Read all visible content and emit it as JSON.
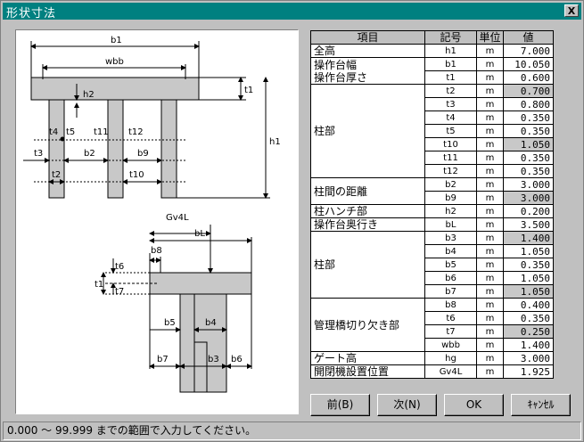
{
  "window": {
    "title": "形状寸法",
    "close": "X"
  },
  "table": {
    "headers": {
      "item": "項目",
      "symbol": "記号",
      "unit": "単位",
      "value": "値"
    },
    "rows": [
      {
        "item": "全高",
        "span": 1,
        "symbol": "h1",
        "unit": "m",
        "value": "7.000",
        "shaded": false
      },
      {
        "item": "操作台幅\n操作台厚さ",
        "span": 2,
        "symbol": "b1",
        "unit": "m",
        "value": "10.050",
        "shaded": false
      },
      {
        "symbol": "t1",
        "unit": "m",
        "value": "0.600",
        "shaded": false
      },
      {
        "item": "柱部",
        "span": 7,
        "symbol": "t2",
        "unit": "m",
        "value": "0.700",
        "shaded": true
      },
      {
        "symbol": "t3",
        "unit": "m",
        "value": "0.800",
        "shaded": false
      },
      {
        "symbol": "t4",
        "unit": "m",
        "value": "0.350",
        "shaded": false
      },
      {
        "symbol": "t5",
        "unit": "m",
        "value": "0.350",
        "shaded": false
      },
      {
        "symbol": "t10",
        "unit": "m",
        "value": "1.050",
        "shaded": true
      },
      {
        "symbol": "t11",
        "unit": "m",
        "value": "0.350",
        "shaded": false
      },
      {
        "symbol": "t12",
        "unit": "m",
        "value": "0.350",
        "shaded": false
      },
      {
        "item": "柱間の距離",
        "span": 2,
        "symbol": "b2",
        "unit": "m",
        "value": "3.000",
        "shaded": false
      },
      {
        "symbol": "b9",
        "unit": "m",
        "value": "3.000",
        "shaded": true
      },
      {
        "item": "柱ハンチ部",
        "span": 1,
        "symbol": "h2",
        "unit": "m",
        "value": "0.200",
        "shaded": false
      },
      {
        "item": "操作台奥行き",
        "span": 1,
        "symbol": "bL",
        "unit": "m",
        "value": "3.500",
        "shaded": false
      },
      {
        "item": "柱部",
        "span": 5,
        "symbol": "b3",
        "unit": "m",
        "value": "1.400",
        "shaded": true
      },
      {
        "symbol": "b4",
        "unit": "m",
        "value": "1.050",
        "shaded": false
      },
      {
        "symbol": "b5",
        "unit": "m",
        "value": "0.350",
        "shaded": false
      },
      {
        "symbol": "b6",
        "unit": "m",
        "value": "1.050",
        "shaded": false
      },
      {
        "symbol": "b7",
        "unit": "m",
        "value": "1.050",
        "shaded": true
      },
      {
        "item": "管理橋切り欠き部",
        "span": 4,
        "symbol": "b8",
        "unit": "m",
        "value": "0.400",
        "shaded": false
      },
      {
        "symbol": "t6",
        "unit": "m",
        "value": "0.350",
        "shaded": false
      },
      {
        "symbol": "t7",
        "unit": "m",
        "value": "0.250",
        "shaded": true
      },
      {
        "symbol": "wbb",
        "unit": "m",
        "value": "1.400",
        "shaded": false
      },
      {
        "item": "ゲート高",
        "span": 1,
        "symbol": "hg",
        "unit": "m",
        "value": "3.000",
        "shaded": false
      },
      {
        "item": "開閉機設置位置",
        "span": 1,
        "symbol": "Gv4L",
        "unit": "m",
        "value": "1.925",
        "shaded": false
      }
    ]
  },
  "buttons": {
    "prev": "前(B)",
    "next": "次(N)",
    "ok": "OK",
    "cancel": "ｷｬﾝｾﾙ"
  },
  "status": "0.000 ～ 99.999 までの範囲で入力してください。",
  "diagram_labels": {
    "b1": "b1",
    "wbb": "wbb",
    "h2": "h2",
    "t1": "t1",
    "h1": "h1",
    "t4": "t4",
    "t5": "t5",
    "t11": "t11",
    "t12": "t12",
    "t3": "t3",
    "b2": "b2",
    "b9": "b9",
    "t2": "t2",
    "t10": "t10",
    "Gv4L": "Gv4L",
    "bL": "bL",
    "b8": "b8",
    "t6": "t6",
    "t1b": "t1",
    "t7": "t7",
    "b5": "b5",
    "b4": "b4",
    "b7": "b7",
    "b3": "b3",
    "b6": "b6"
  }
}
